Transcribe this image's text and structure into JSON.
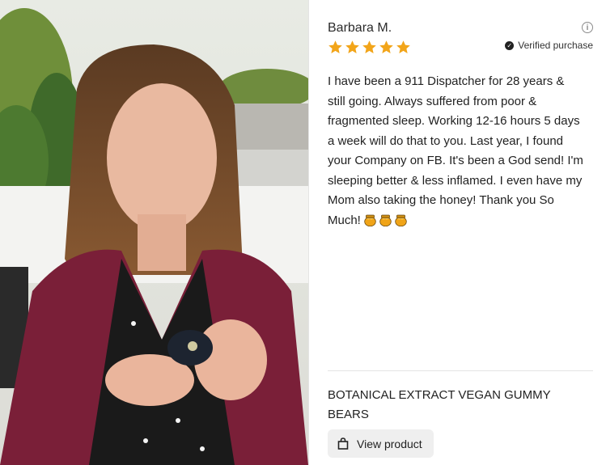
{
  "photo": {
    "alt": "woman-holding-jar"
  },
  "review": {
    "reviewer": "Barbara M.",
    "rating": 5,
    "rating_max": 5,
    "verified_label": "Verified purchase",
    "body": "I have been a 911 Dispatcher for 28 years & still going.  Always suffered from poor & fragmented sleep.  Working 12-16 hours 5 days a week will do that to you.  Last year, I found your Company on FB.  It's been a God send!  I'm sleeping better & less inflamed.  I even have my Mom also taking the honey!  Thank you So Much!",
    "emoji_count": 3
  },
  "product": {
    "name": "BOTANICAL EXTRACT VEGAN GUMMY BEARS",
    "button_label": "View product"
  },
  "colors": {
    "star": "#f2a51a",
    "button_bg": "#efefef",
    "divider": "#e4e4e4"
  }
}
